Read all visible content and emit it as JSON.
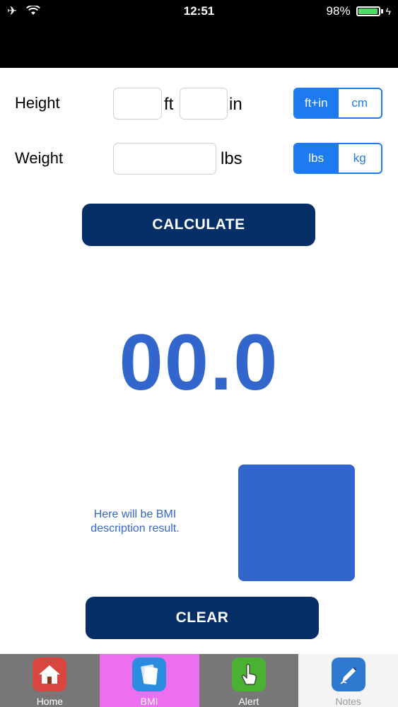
{
  "status": {
    "time": "12:51",
    "battery": "98%",
    "battery_level": 0.98,
    "airplane_icon": "airplane-icon",
    "wifi_icon": "wifi-icon"
  },
  "form": {
    "height_label": "Height",
    "height_ft_unit": "ft",
    "height_in_unit": "in",
    "height_ft_value": "",
    "height_in_value": "",
    "height_units": [
      "ft+in",
      "cm"
    ],
    "height_units_selected": "ft+in",
    "weight_label": "Weight",
    "weight_unit": "lbs",
    "weight_value": "",
    "weight_units": [
      "lbs",
      "kg"
    ],
    "weight_units_selected": "lbs"
  },
  "calculate_label": "CALCULATE",
  "result": {
    "bmi_value": "00.0",
    "description": "Here will be BMI description result.",
    "indicator_color": "#3366cc"
  },
  "clear_label": "CLEAR",
  "tabs": [
    {
      "label": "Home",
      "icon": "home-icon",
      "bg": "#777777",
      "selected": false
    },
    {
      "label": "BMI",
      "icon": "bmi-icon",
      "bg": "#ee6ef0",
      "selected": true
    },
    {
      "label": "Alert",
      "icon": "alert-icon",
      "bg": "#777777",
      "selected": false
    },
    {
      "label": "Notes",
      "icon": "notes-icon",
      "bg": "#f4f4f4",
      "selected": false
    }
  ],
  "colors": {
    "accent": "#1e7bef",
    "button": "#052f66",
    "result_text": "#3366cc"
  }
}
